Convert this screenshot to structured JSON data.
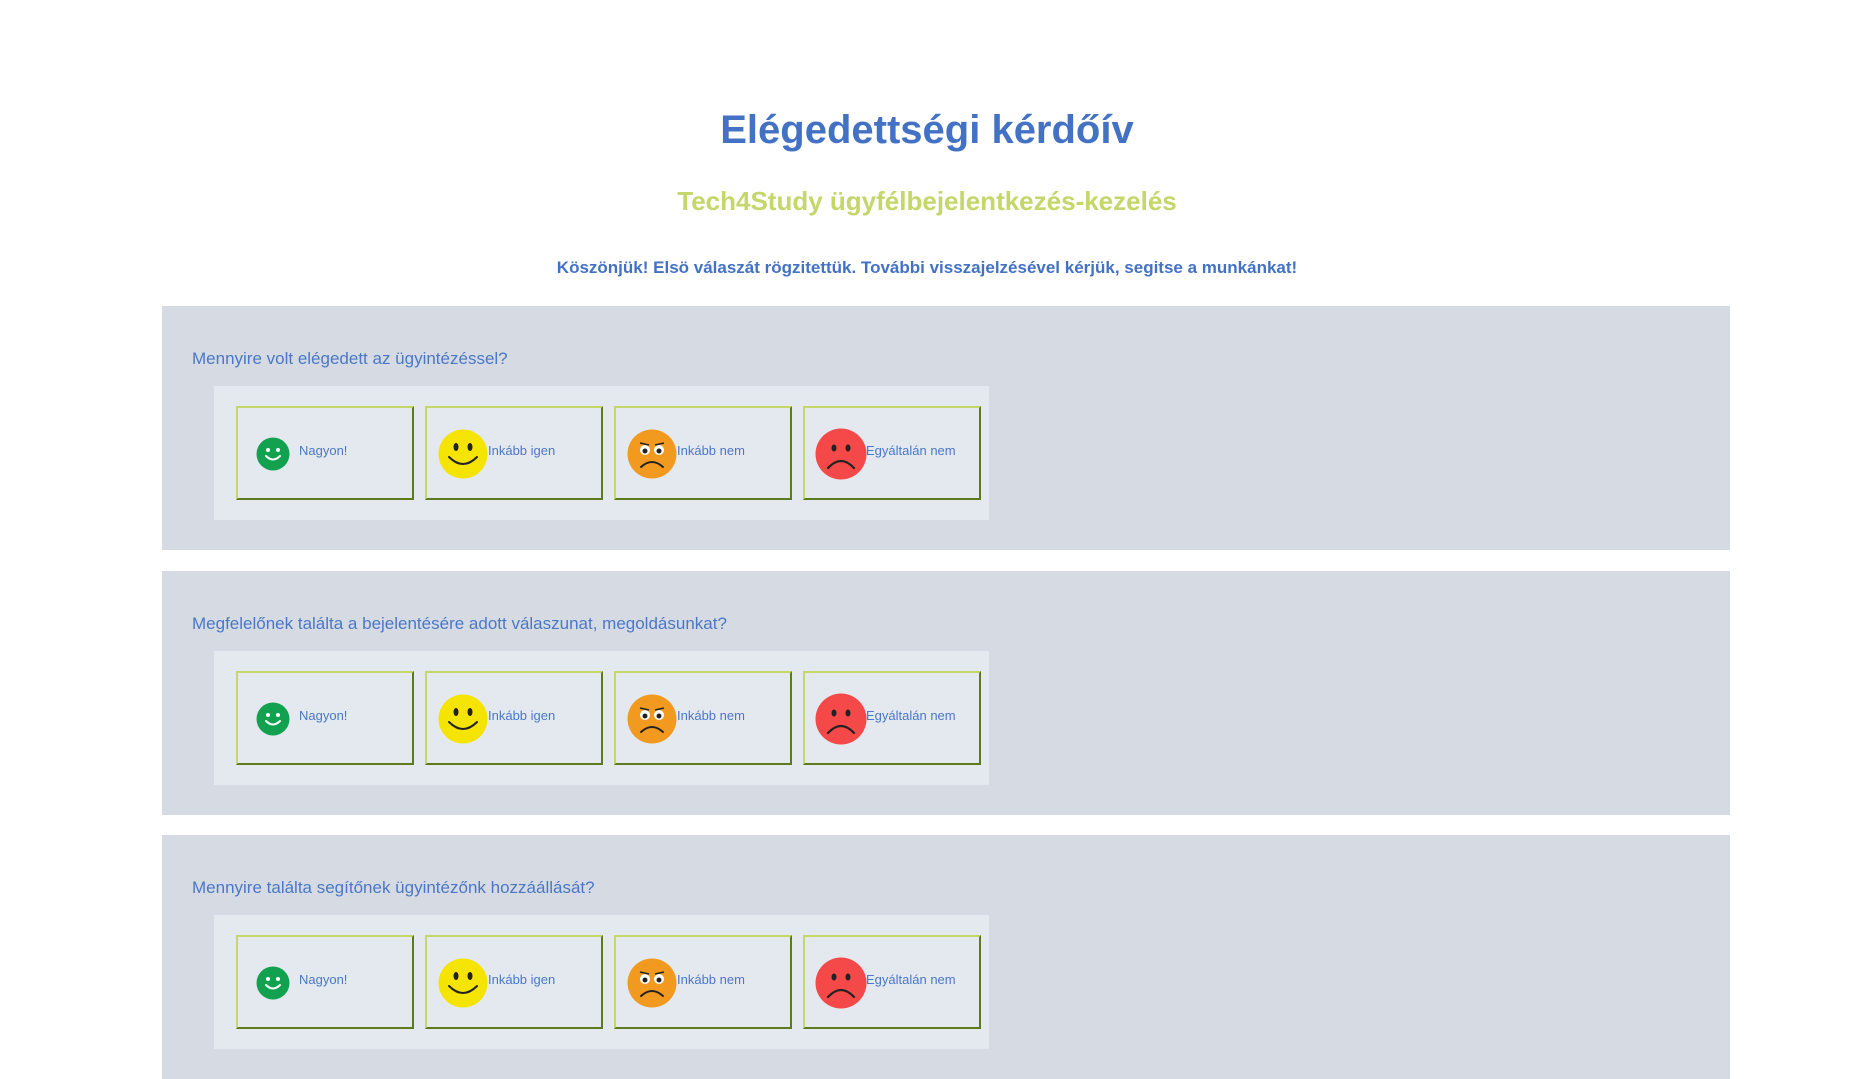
{
  "header": {
    "title": "Elégedettségi kérdőív",
    "subtitle": "Tech4Study ügyfélbejelentkezés-kezelés",
    "thanks": "Köszönjük! Elsö válaszát rögzitettük. További visszajelzésével kérjük, segitse a munkánkat!"
  },
  "colors": {
    "accent": "#4372c4",
    "subtitle": "#c5d66a",
    "panel": "#d6dae3",
    "very_satisfied": "#12a14f",
    "satisfied": "#f5e400",
    "unsatisfied": "#f29a1f",
    "very_unsatisfied": "#f54848"
  },
  "questions": [
    {
      "text": "Mennyire volt elégedett az ügyintézéssel?",
      "options": [
        {
          "label": "Nagyon!",
          "icon": "very-happy-face-icon"
        },
        {
          "label": "Inkább igen",
          "icon": "happy-face-icon"
        },
        {
          "label": "Inkább nem",
          "icon": "worried-face-icon"
        },
        {
          "label": "Egyáltalán nem",
          "icon": "sad-face-icon"
        }
      ]
    },
    {
      "text": "Megfelelőnek találta a bejelentésére adott válaszunat, megoldásunkat?",
      "options": [
        {
          "label": "Nagyon!",
          "icon": "very-happy-face-icon"
        },
        {
          "label": "Inkább igen",
          "icon": "happy-face-icon"
        },
        {
          "label": "Inkább nem",
          "icon": "worried-face-icon"
        },
        {
          "label": "Egyáltalán nem",
          "icon": "sad-face-icon"
        }
      ]
    },
    {
      "text": "Mennyire találta segítőnek ügyintézőnk hozzáállását?",
      "options": [
        {
          "label": "Nagyon!",
          "icon": "very-happy-face-icon"
        },
        {
          "label": "Inkább igen",
          "icon": "happy-face-icon"
        },
        {
          "label": "Inkább nem",
          "icon": "worried-face-icon"
        },
        {
          "label": "Egyáltalán nem",
          "icon": "sad-face-icon"
        }
      ]
    }
  ]
}
